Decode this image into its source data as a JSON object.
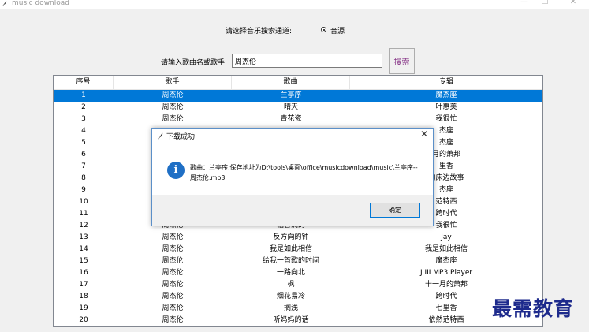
{
  "window": {
    "title": "music download",
    "minimize": "—",
    "maximize": "☐",
    "close": "✕"
  },
  "channel": {
    "label": "请选择音乐搜索通道:",
    "option": "音源"
  },
  "search": {
    "label": "请输入歌曲名或歌手:",
    "value": "周杰伦",
    "button": "搜索"
  },
  "table": {
    "columns": [
      "序号",
      "歌手",
      "歌曲",
      "专辑"
    ],
    "rows": [
      [
        "1",
        "周杰伦",
        "兰亭序",
        "魔杰座"
      ],
      [
        "2",
        "周杰伦",
        "晴天",
        "叶惠美"
      ],
      [
        "3",
        "周杰伦",
        "青花瓷",
        "我很忙"
      ],
      [
        "4",
        "",
        "",
        "杰座"
      ],
      [
        "5",
        "",
        "",
        "杰座"
      ],
      [
        "6",
        "",
        "",
        "月的萧邦"
      ],
      [
        "7",
        "",
        "",
        "里香"
      ],
      [
        "8",
        "",
        "",
        "的床边故事"
      ],
      [
        "9",
        "",
        "",
        "杰座"
      ],
      [
        "10",
        "",
        "",
        "范特西"
      ],
      [
        "11",
        "",
        "",
        "跨时代"
      ],
      [
        "12",
        "周杰伦",
        "稻香满的",
        "我很忙"
      ],
      [
        "13",
        "周杰伦",
        "反方向的钟",
        "Jay"
      ],
      [
        "14",
        "周杰伦",
        "我是如此相信",
        "我是如此相信"
      ],
      [
        "15",
        "周杰伦",
        "给我一首歌的时间",
        "魔杰座"
      ],
      [
        "16",
        "周杰伦",
        "一路向北",
        "J III MP3 Player"
      ],
      [
        "17",
        "周杰伦",
        "枫",
        "十一月的萧邦"
      ],
      [
        "18",
        "周杰伦",
        "烟花易冷",
        "跨时代"
      ],
      [
        "19",
        "周杰伦",
        "搁浅",
        "七里香"
      ],
      [
        "20",
        "周杰伦",
        "听妈妈的话",
        "依然范特西"
      ]
    ]
  },
  "dialog": {
    "title": "下载成功",
    "message": "歌曲：兰亭序,保存地址为D:\\tools\\桌面\\office\\musicdownload\\music\\兰亭序--周杰伦.mp3",
    "ok": "确定",
    "close": "✕",
    "icon_glyph": "i"
  },
  "watermark": "最需教育",
  "colors": {
    "selection": "#0078d7",
    "info": "#1f6fc5",
    "watermark": "#1d2a8c"
  }
}
